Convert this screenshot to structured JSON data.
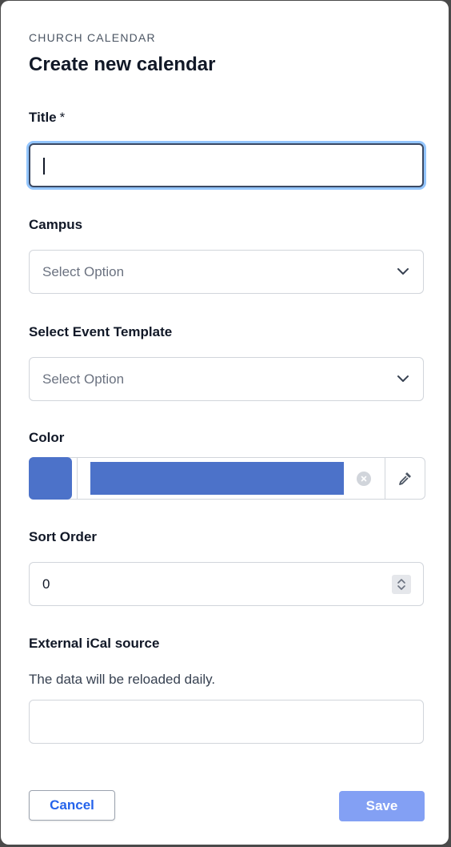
{
  "header": {
    "overline": "CHURCH CALENDAR",
    "title": "Create new calendar"
  },
  "form": {
    "title": {
      "label": "Title",
      "required_mark": "*",
      "value": ""
    },
    "campus": {
      "label": "Campus",
      "placeholder": "Select Option"
    },
    "event_template": {
      "label": "Select Event Template",
      "placeholder": "Select Option"
    },
    "color": {
      "label": "Color",
      "value_color": "#4c72c9"
    },
    "sort_order": {
      "label": "Sort Order",
      "value": "0"
    },
    "ical": {
      "label": "External iCal source",
      "helper": "The data will be reloaded daily.",
      "value": ""
    }
  },
  "actions": {
    "cancel_label": "Cancel",
    "save_label": "Save"
  },
  "colors": {
    "primary": "#2563eb",
    "save_disabled": "#83a0f4",
    "focus_ring": "#93c5fd"
  },
  "icons": {
    "select_chevron": "chevron-down-icon",
    "clear": "clear-circle-icon",
    "picker": "eyedropper-icon",
    "spinner": "stepper-icon"
  }
}
